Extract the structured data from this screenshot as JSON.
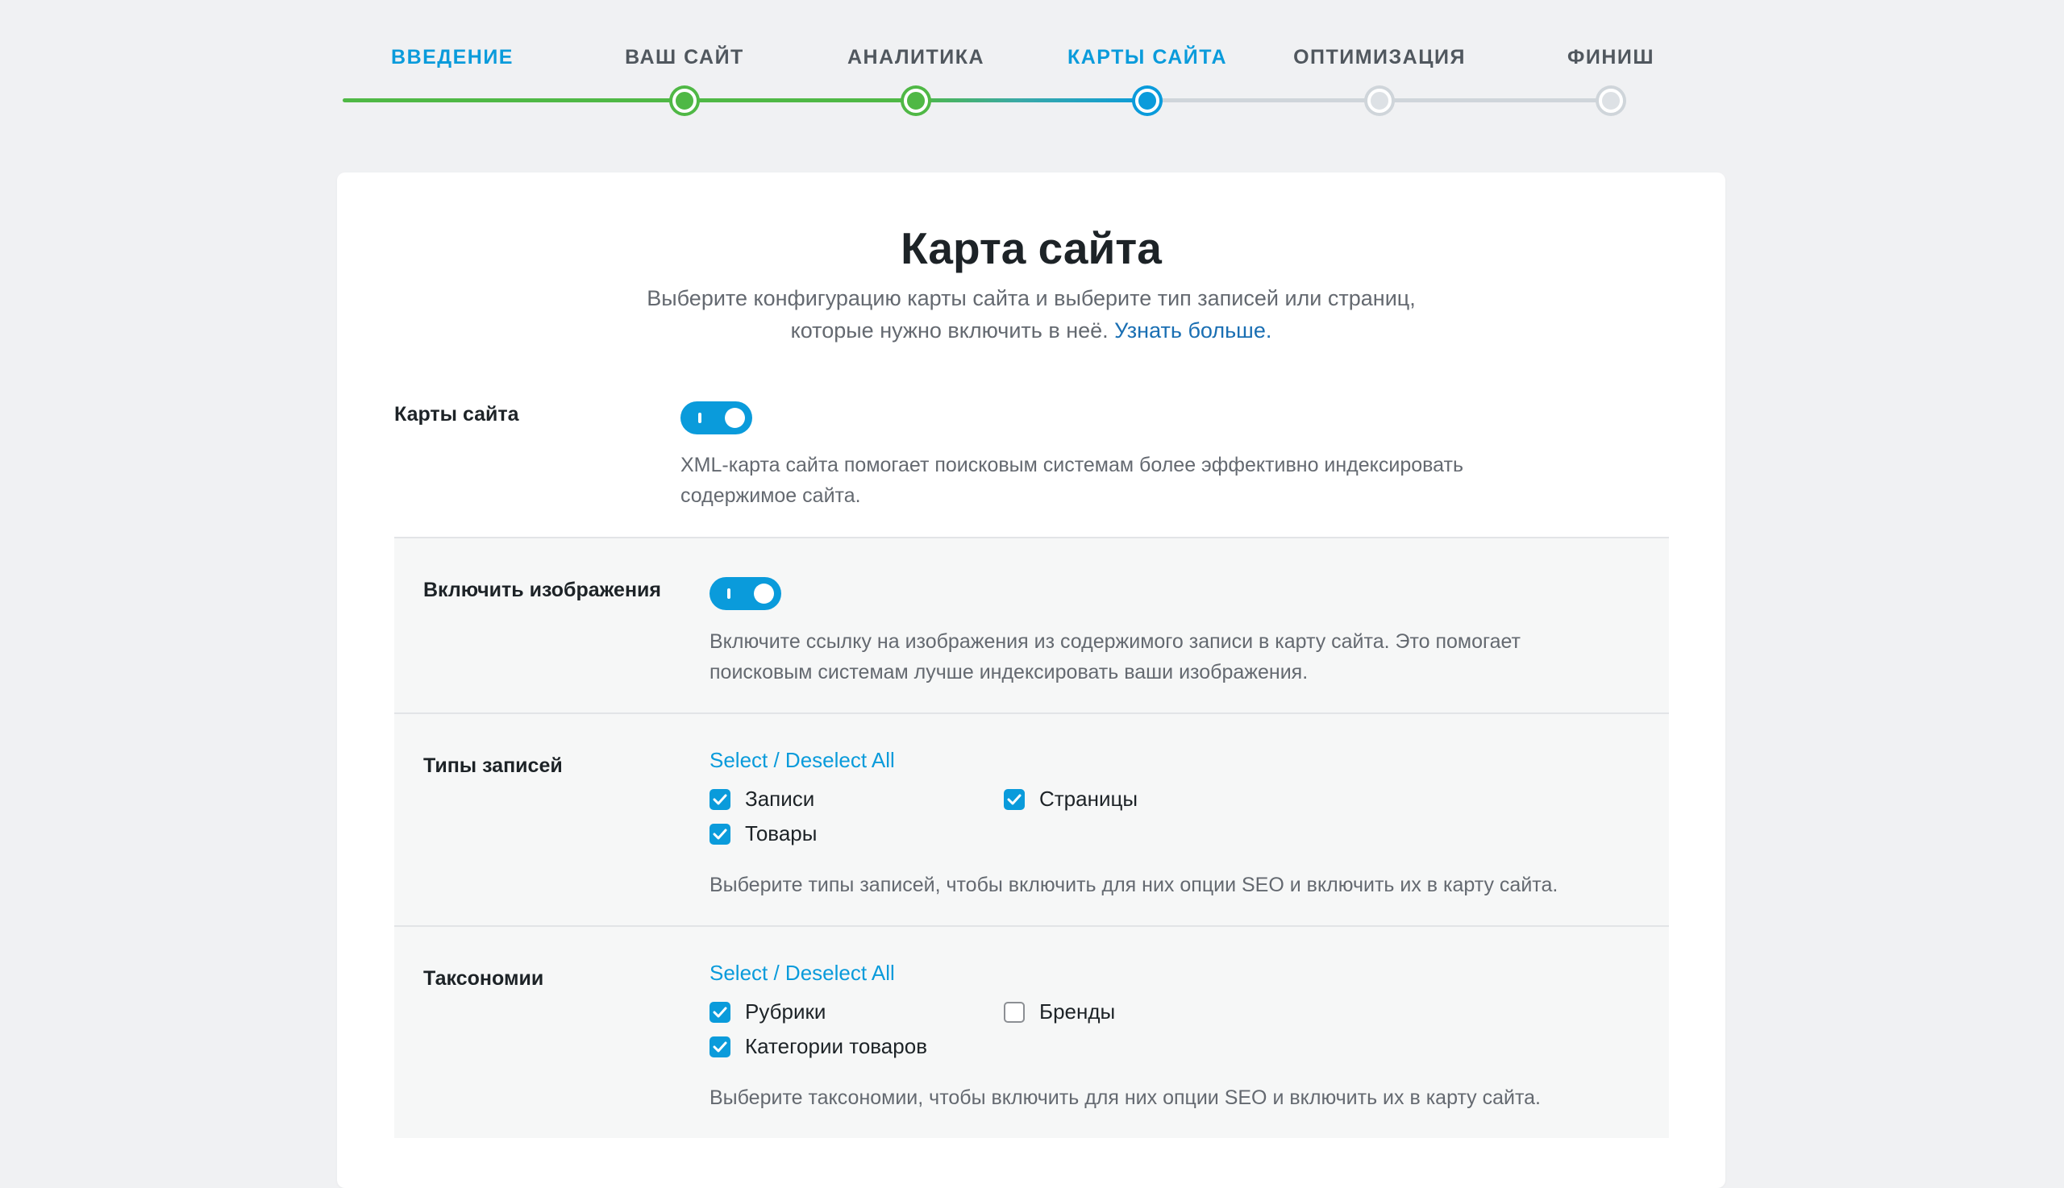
{
  "stepper": {
    "steps": [
      {
        "label": "ВВЕДЕНИЕ",
        "state": "intro"
      },
      {
        "label": "ВАШ САЙТ",
        "state": "done"
      },
      {
        "label": "АНАЛИТИКА",
        "state": "done"
      },
      {
        "label": "КАРТЫ САЙТА",
        "state": "current"
      },
      {
        "label": "ОПТИМИЗАЦИЯ",
        "state": "todo"
      },
      {
        "label": "ФИНИШ",
        "state": "todo"
      }
    ],
    "colors": {
      "done": "#4fb845",
      "current": "#0a9bdb",
      "todo": "#cfd5da"
    }
  },
  "card": {
    "title": "Карта сайта",
    "subtitle_line1": "Выберите конфигурацию карты сайта и выберите тип записей или страниц,",
    "subtitle_line2": "которые нужно включить в неё.",
    "learn_more": "Узнать больше."
  },
  "sitemaps": {
    "label": "Карты сайта",
    "enabled": true,
    "description_line1": "XML-карта сайта помогает поисковым системам более эффективно индексировать",
    "description_line2": "содержимое сайта."
  },
  "images": {
    "label": "Включить изображения",
    "enabled": true,
    "description_line1": "Включите ссылку на изображения из содержимого записи в карту сайта. Это помогает",
    "description_line2": "поисковым системам лучше индексировать ваши изображения."
  },
  "post_types": {
    "label": "Типы записей",
    "select_all": "Select / Deselect All",
    "items": [
      {
        "label": "Записи",
        "checked": true
      },
      {
        "label": "Страницы",
        "checked": true
      },
      {
        "label": "Товары",
        "checked": true
      }
    ],
    "description": "Выберите типы записей, чтобы включить для них опции SEO и включить их в карту сайта."
  },
  "taxonomies": {
    "label": "Таксономии",
    "select_all": "Select / Deselect All",
    "items": [
      {
        "label": "Рубрики",
        "checked": true
      },
      {
        "label": "Бренды",
        "checked": false
      },
      {
        "label": "Категории товаров",
        "checked": true
      }
    ],
    "description": "Выберите таксономии, чтобы включить для них опции SEO и включить их в карту сайта."
  },
  "accent_color": "#0a9bdb"
}
